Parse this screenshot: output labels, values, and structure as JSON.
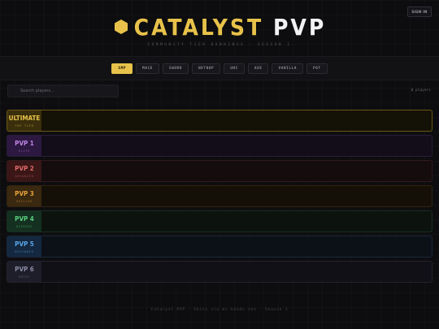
{
  "header": {
    "signin_label": "SIGN IN",
    "title_part1": "CATALYST",
    "title_part2": "PVP",
    "subtitle": "COMMUNITY TIER RANKINGS · SEASON 1",
    "accent": "#e8c24a",
    "logo_icon": "hexagon-icon"
  },
  "tabs": [
    {
      "label": "SMP",
      "active": true
    },
    {
      "label": "MACE",
      "active": false
    },
    {
      "label": "SWORD",
      "active": false
    },
    {
      "label": "NETHOP",
      "active": false
    },
    {
      "label": "UHC",
      "active": false
    },
    {
      "label": "AXE",
      "active": false
    },
    {
      "label": "VANILLA",
      "active": false
    },
    {
      "label": "POT",
      "active": false
    }
  ],
  "search": {
    "placeholder": "Search players...",
    "icon": "search-icon"
  },
  "player_count": "0 players",
  "tiers": [
    {
      "name": "ULTIMATE",
      "sub": "TOP TIER",
      "color": "#e8c24a",
      "bg": "#3a2f0c",
      "row_bg": "#141106",
      "border": "#6b5616"
    },
    {
      "name": "PVP 1",
      "sub": "ELITE",
      "color": "#c084e8",
      "bg": "#2c1840",
      "row_bg": "#120d18",
      "border": "#2a1d38"
    },
    {
      "name": "PVP 2",
      "sub": "ADVANCED",
      "color": "#e26a6a",
      "bg": "#3a1616",
      "row_bg": "#140c0d",
      "border": "#331a1c"
    },
    {
      "name": "PVP 3",
      "sub": "SKILLED",
      "color": "#e8a23a",
      "bg": "#3a2810",
      "row_bg": "#141008",
      "border": "#31240f"
    },
    {
      "name": "PVP 4",
      "sub": "AVERAGE",
      "color": "#5ccf7e",
      "bg": "#143020",
      "row_bg": "#0c130f",
      "border": "#1a2e20"
    },
    {
      "name": "PVP 5",
      "sub": "BEGINNER",
      "color": "#5aa6e8",
      "bg": "#142840",
      "row_bg": "#0c1118",
      "border": "#1b2738"
    },
    {
      "name": "PVP 6",
      "sub": "ENTRY",
      "color": "#8a8aa4",
      "bg": "#1e1e2a",
      "row_bg": "#101016",
      "border": "#23232e"
    }
  ],
  "footer": "Catalyst PVP · Skins via mc-heads.net · Season 1"
}
